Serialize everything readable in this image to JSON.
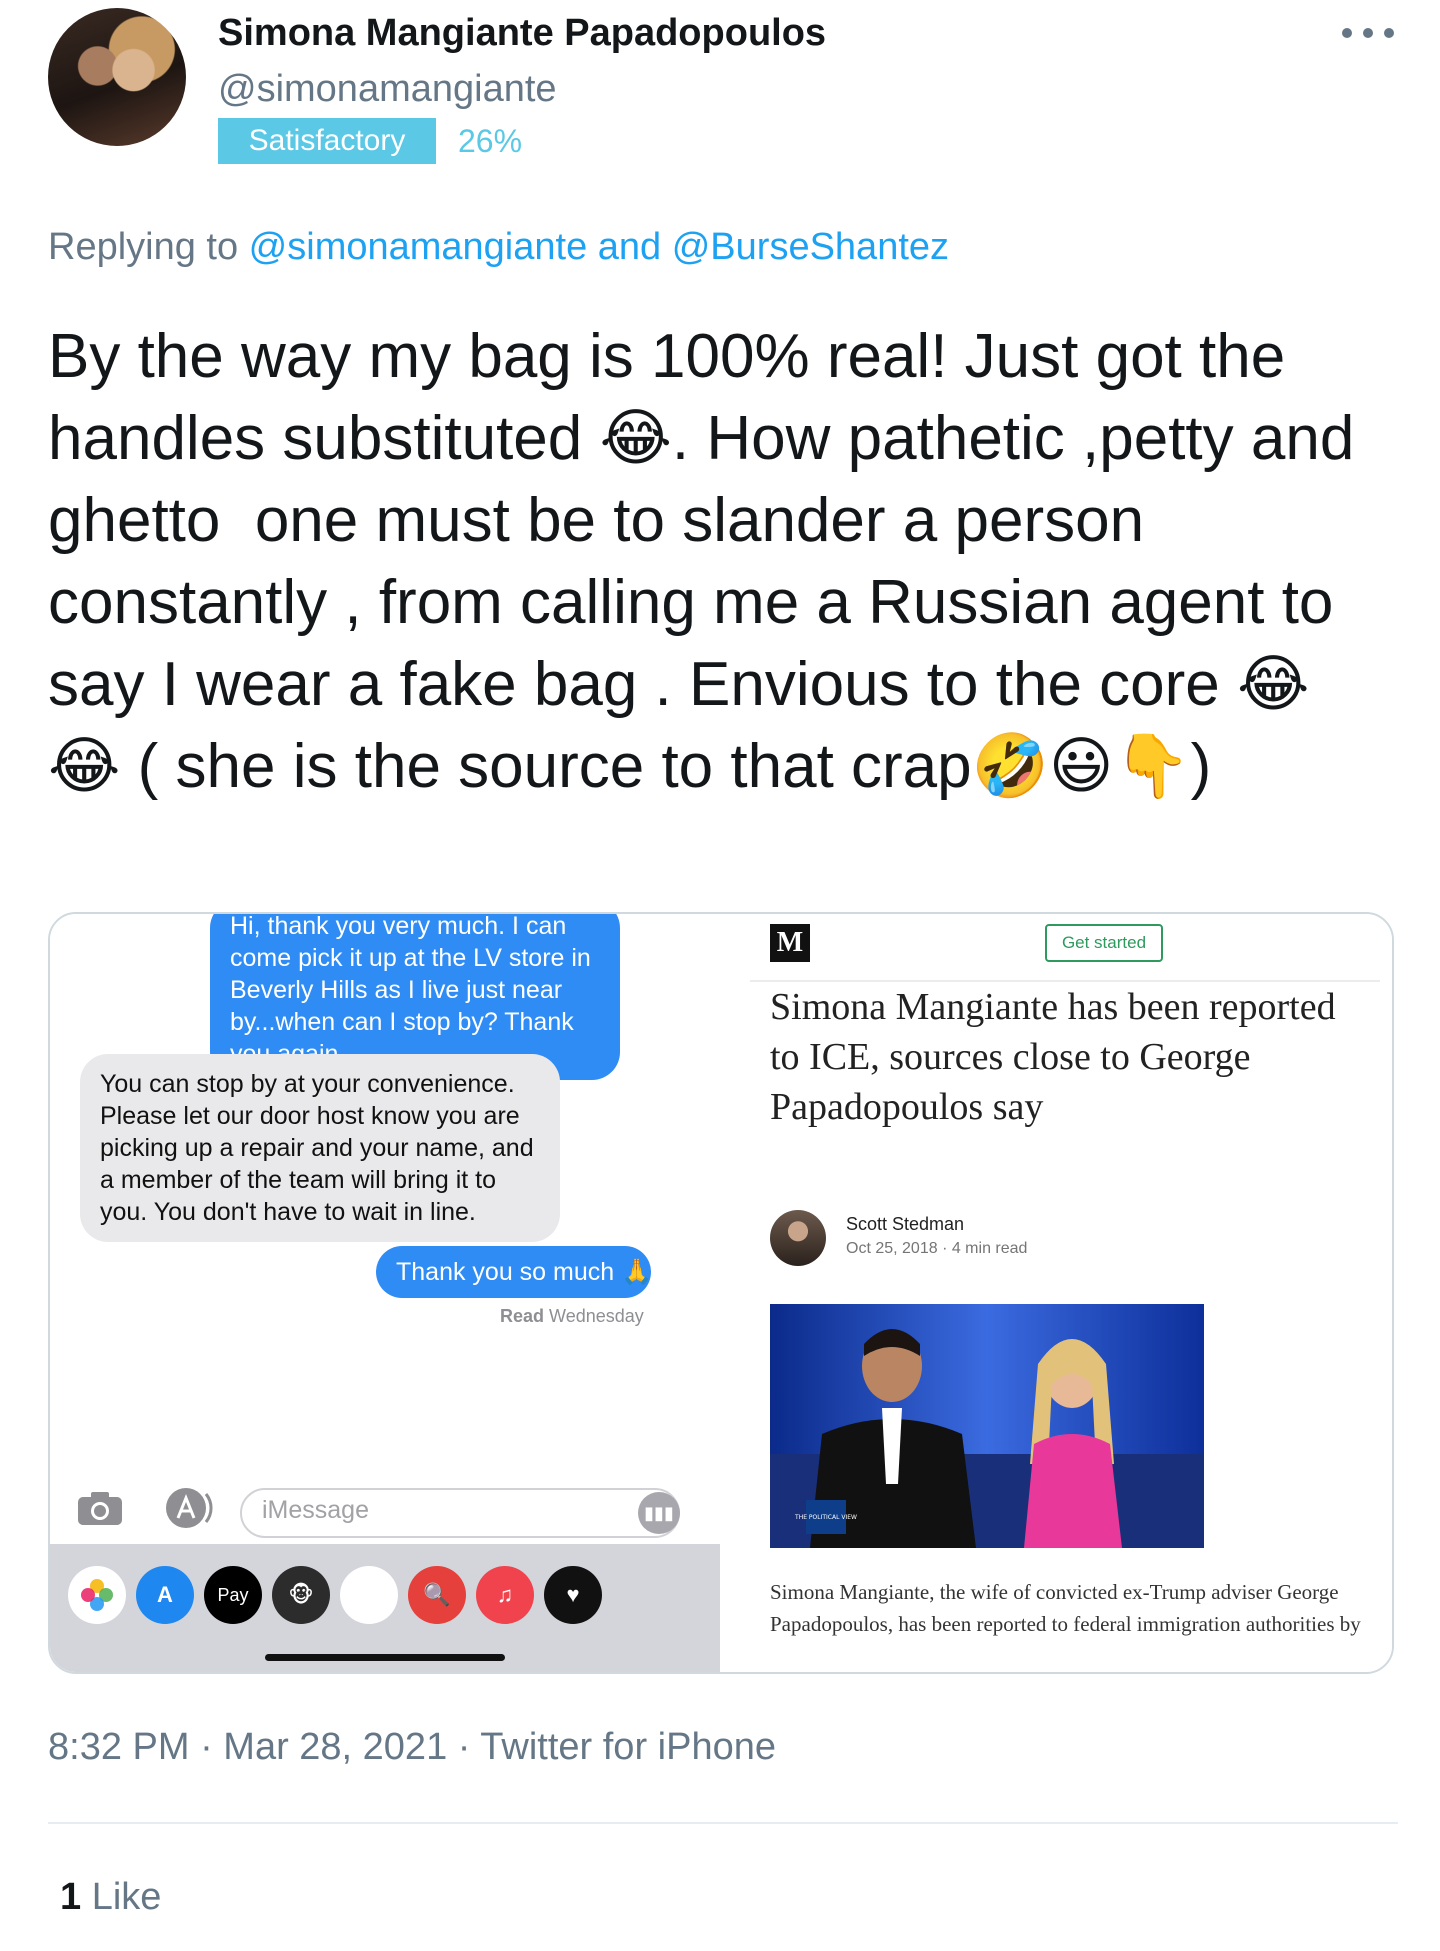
{
  "header": {
    "display_name": "Simona Mangiante Papadopoulos",
    "handle": "@simonamangiante",
    "badge_label": "Satisfactory",
    "badge_percent": "26%",
    "more_icon": "more-horizontal-icon"
  },
  "reply": {
    "prefix": "Replying to ",
    "mention1": "@simonamangiante",
    "joiner": " and ",
    "mention2": "@BurseShantez"
  },
  "tweet_text": "By the way my bag is 100% real! Just got the handles substituted 😂. How pathetic ,petty and ghetto  one must be to slander a person constantly , from calling me a Russian agent to say I wear a fake bag . Envious to the core 😂😂 ( she is the source to that crap🤣😃👇)",
  "media": {
    "imessage": {
      "sent_bubble_1": "Hi, thank you very much. I can come pick it up at the LV store in Beverly Hills as I live just near by...when can I stop by? Thank you again",
      "received_bubble": "You can stop by at your convenience. Please let our door host know you are picking up a repair and your name, and a member of the team will bring it to you. You don't have to wait in line.",
      "sent_bubble_2": "Thank you so much 🙏",
      "read_label": "Read",
      "read_day": "Wednesday",
      "input_placeholder": "iMessage",
      "apple_pay_label": "Pay"
    },
    "article": {
      "logo_letter": "M",
      "get_started": "Get started",
      "title": "Simona Mangiante has been reported to ICE, sources close to George Papadopoulos say",
      "author": "Scott Stedman",
      "meta": "Oct 25, 2018 · 4 min read",
      "photo_badge": "THE POLITICAL VIEW",
      "caption": "Simona Mangiante, the wife of convicted ex-Trump adviser George Papadopoulos, has been reported to federal immigration authorities by"
    }
  },
  "footer": {
    "timestamp": "8:32 PM · Mar 28, 2021 · Twitter for iPhone",
    "like_count": "1",
    "like_label": " Like"
  },
  "colors": {
    "link_blue": "#1da1f2",
    "muted": "#657786",
    "badge": "#5bc8e6",
    "imessage_blue": "#2f8cf5"
  }
}
